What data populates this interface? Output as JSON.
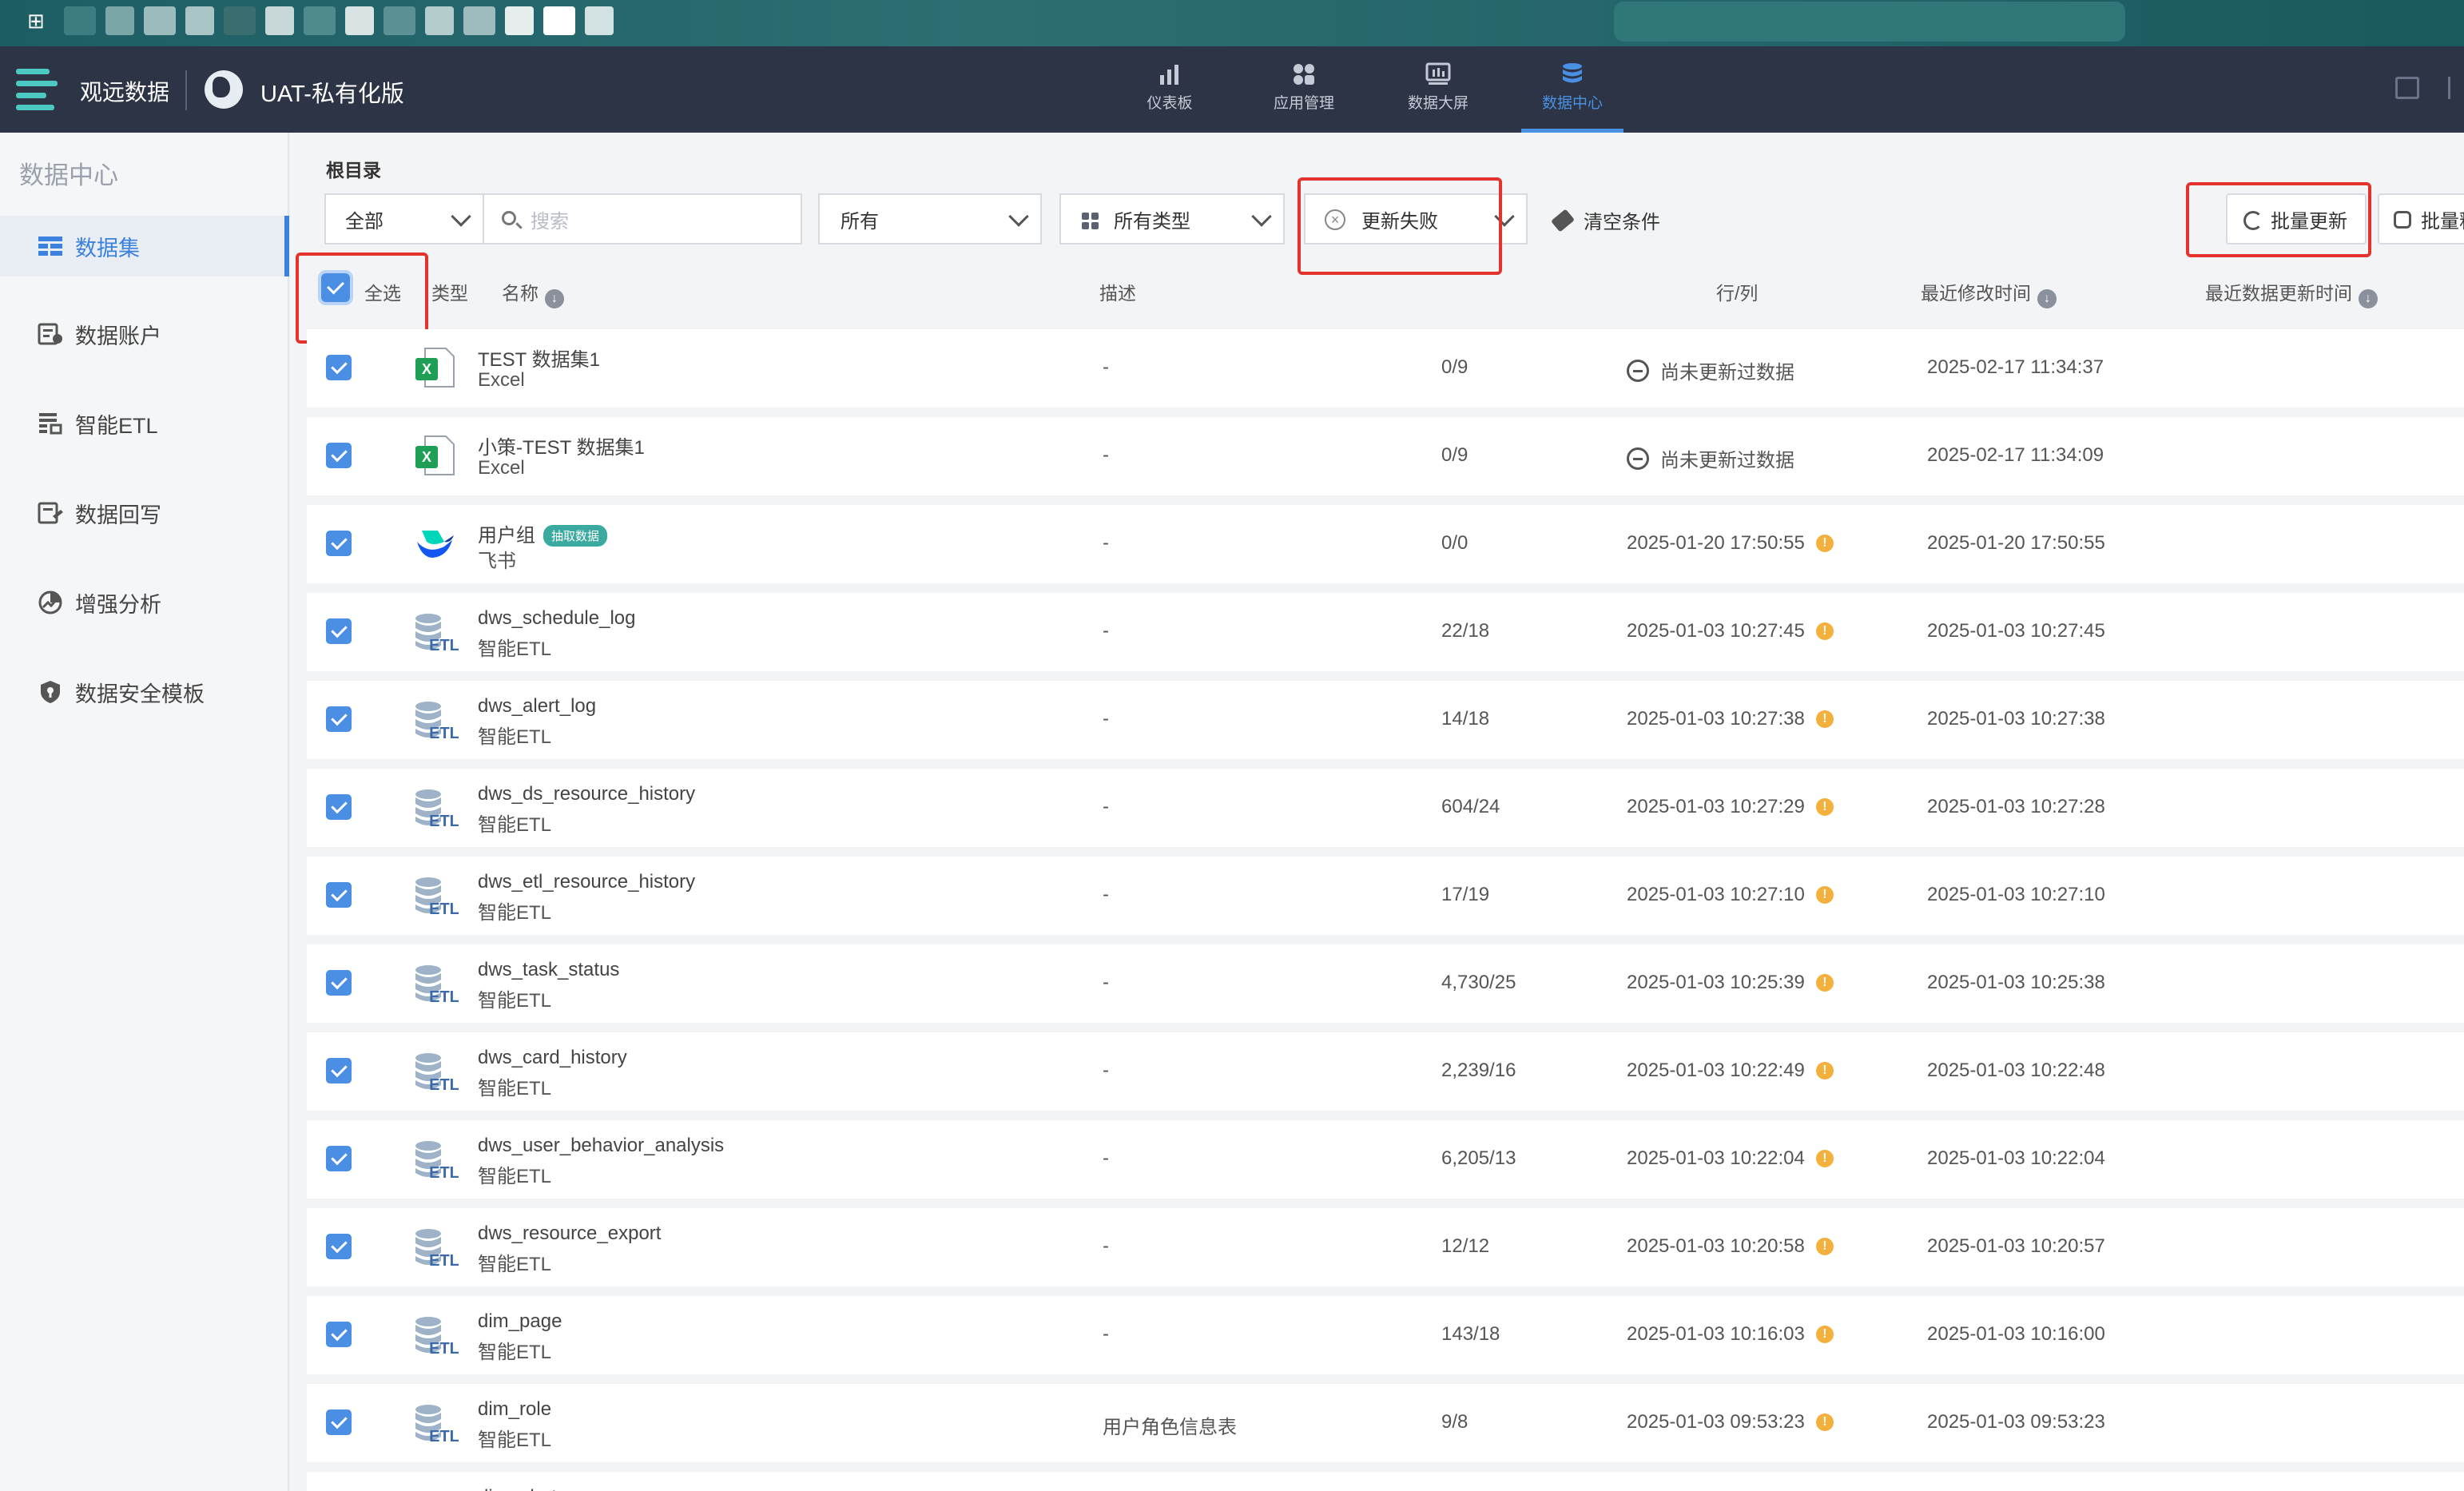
{
  "browser": {
    "grid_icon": "grid-icon"
  },
  "header": {
    "brand": "观远数据",
    "workspace": "UAT-私有化版",
    "nav": [
      {
        "label": "仪表板",
        "icon": "bar-chart-icon",
        "active": false
      },
      {
        "label": "应用管理",
        "icon": "apps-icon",
        "active": false
      },
      {
        "label": "数据大屏",
        "icon": "screen-icon",
        "active": false
      },
      {
        "label": "数据中心",
        "icon": "database-icon",
        "active": true
      }
    ]
  },
  "sidebar": {
    "title": "数据中心",
    "items": [
      {
        "label": "数据集",
        "icon": "dataset-icon",
        "active": true
      },
      {
        "label": "数据账户",
        "icon": "account-icon",
        "active": false
      },
      {
        "label": "智能ETL",
        "icon": "etl-icon",
        "active": false
      },
      {
        "label": "数据回写",
        "icon": "writeback-icon",
        "active": false
      },
      {
        "label": "增强分析",
        "icon": "analysis-icon",
        "active": false
      },
      {
        "label": "数据安全模板",
        "icon": "shield-icon",
        "active": false
      }
    ]
  },
  "main": {
    "breadcrumb": "根目录",
    "filters": {
      "scope": "全部",
      "search_placeholder": "搜索",
      "owner": "所有",
      "type": "所有类型",
      "status": "更新失败",
      "clear": "清空条件"
    },
    "actions": {
      "batch_refresh": "批量更新",
      "batch_other": "批量释"
    },
    "columns": {
      "select_all": "全选",
      "type": "类型",
      "name": "名称",
      "desc": "描述",
      "rows_cols": "行/列",
      "modified": "最近修改时间",
      "updated": "最近数据更新时间"
    },
    "rows": [
      {
        "name": "TEST 数据集1",
        "sub": "Excel",
        "kind": "excel",
        "desc": "-",
        "rc": "0/9",
        "mod": "尚未更新过数据",
        "mod_state": "never",
        "upd": "2025-02-17 11:34:37"
      },
      {
        "name": "小策-TEST 数据集1",
        "sub": "Excel",
        "kind": "excel",
        "desc": "-",
        "rc": "0/9",
        "mod": "尚未更新过数据",
        "mod_state": "never",
        "upd": "2025-02-17 11:34:09"
      },
      {
        "name": "用户组",
        "badge": "抽取数据",
        "sub": "飞书",
        "kind": "feishu",
        "desc": "-",
        "rc": "0/0",
        "mod": "2025-01-20 17:50:55",
        "mod_state": "warn",
        "upd": "2025-01-20 17:50:55"
      },
      {
        "name": "dws_schedule_log",
        "sub": "智能ETL",
        "kind": "etl",
        "desc": "-",
        "rc": "22/18",
        "mod": "2025-01-03 10:27:45",
        "mod_state": "warn",
        "upd": "2025-01-03 10:27:45"
      },
      {
        "name": "dws_alert_log",
        "sub": "智能ETL",
        "kind": "etl",
        "desc": "-",
        "rc": "14/18",
        "mod": "2025-01-03 10:27:38",
        "mod_state": "warn",
        "upd": "2025-01-03 10:27:38"
      },
      {
        "name": "dws_ds_resource_history",
        "sub": "智能ETL",
        "kind": "etl",
        "desc": "-",
        "rc": "604/24",
        "mod": "2025-01-03 10:27:29",
        "mod_state": "warn",
        "upd": "2025-01-03 10:27:28"
      },
      {
        "name": "dws_etl_resource_history",
        "sub": "智能ETL",
        "kind": "etl",
        "desc": "-",
        "rc": "17/19",
        "mod": "2025-01-03 10:27:10",
        "mod_state": "warn",
        "upd": "2025-01-03 10:27:10"
      },
      {
        "name": "dws_task_status",
        "sub": "智能ETL",
        "kind": "etl",
        "desc": "-",
        "rc": "4,730/25",
        "mod": "2025-01-03 10:25:39",
        "mod_state": "warn",
        "upd": "2025-01-03 10:25:38"
      },
      {
        "name": "dws_card_history",
        "sub": "智能ETL",
        "kind": "etl",
        "desc": "-",
        "rc": "2,239/16",
        "mod": "2025-01-03 10:22:49",
        "mod_state": "warn",
        "upd": "2025-01-03 10:22:48"
      },
      {
        "name": "dws_user_behavior_analysis",
        "sub": "智能ETL",
        "kind": "etl",
        "desc": "-",
        "rc": "6,205/13",
        "mod": "2025-01-03 10:22:04",
        "mod_state": "warn",
        "upd": "2025-01-03 10:22:04"
      },
      {
        "name": "dws_resource_export",
        "sub": "智能ETL",
        "kind": "etl",
        "desc": "-",
        "rc": "12/12",
        "mod": "2025-01-03 10:20:58",
        "mod_state": "warn",
        "upd": "2025-01-03 10:20:57"
      },
      {
        "name": "dim_page",
        "sub": "智能ETL",
        "kind": "etl",
        "desc": "-",
        "rc": "143/18",
        "mod": "2025-01-03 10:16:03",
        "mod_state": "warn",
        "upd": "2025-01-03 10:16:00"
      },
      {
        "name": "dim_role",
        "sub": "智能ETL",
        "kind": "etl",
        "desc": "用户角色信息表",
        "rc": "9/8",
        "mod": "2025-01-03 09:53:23",
        "mod_state": "warn",
        "upd": "2025-01-03 09:53:23"
      },
      {
        "name": "dim_alert",
        "sub": "",
        "kind": "etl",
        "desc": "",
        "rc": "",
        "mod": "",
        "mod_state": "none",
        "upd": ""
      }
    ]
  },
  "colors": {
    "accent": "#4a8fe4",
    "header_bg": "#2c3445",
    "warn": "#f4b03d",
    "highlight": "#e5322d"
  }
}
